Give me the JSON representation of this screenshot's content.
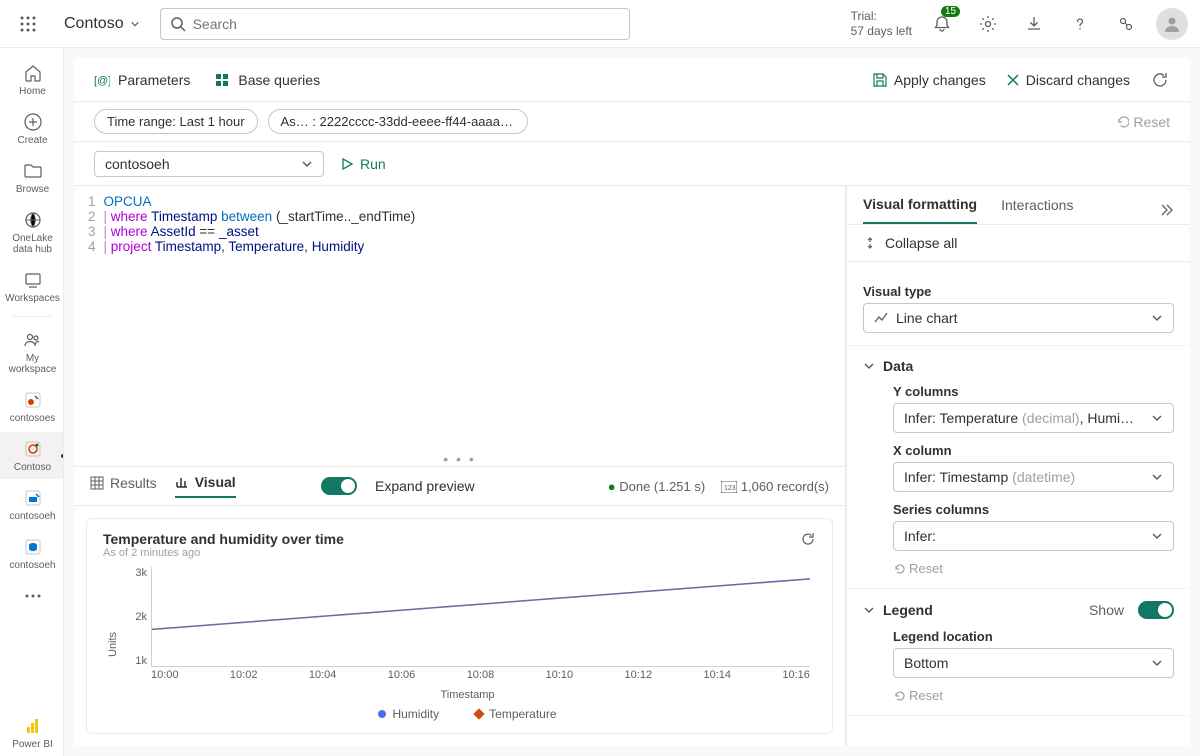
{
  "topbar": {
    "workspace": "Contoso",
    "search_placeholder": "Search",
    "trial_line1": "Trial:",
    "trial_line2": "57 days left",
    "notifications_count": "15"
  },
  "rail": {
    "items": [
      {
        "label": "Home"
      },
      {
        "label": "Create"
      },
      {
        "label": "Browse"
      },
      {
        "label": "OneLake data hub"
      },
      {
        "label": "Workspaces"
      },
      {
        "label": "My workspace"
      },
      {
        "label": "contosoes"
      },
      {
        "label": "Contoso"
      },
      {
        "label": "contosoeh"
      },
      {
        "label": "contosoeh"
      },
      {
        "label": "Power BI"
      }
    ]
  },
  "toolbar1": {
    "parameters": "Parameters",
    "base_queries": "Base queries",
    "apply": "Apply changes",
    "discard": "Discard changes"
  },
  "toolbar2": {
    "time_range": "Time range: Last 1 hour",
    "asset": "As… : 2222cccc-33dd-eeee-ff44-aaaaa…",
    "reset": "Reset"
  },
  "toolbar3": {
    "source": "contosoeh",
    "run": "Run"
  },
  "code": {
    "line_nums": [
      "1",
      "2",
      "3",
      "4"
    ],
    "l1_tbl": "OPCUA",
    "l2_pipe": "|",
    "l2_where": "where",
    "l2_col": "Timestamp",
    "l2_between": "between",
    "l2_args": "(_startTime.._endTime)",
    "l3_pipe": "|",
    "l3_where": "where",
    "l3_col": "AssetId",
    "l3_eq": "==",
    "l3_val": "_asset",
    "l4_pipe": "|",
    "l4_proj": "project",
    "l4_c1": "Timestamp",
    "l4_c2": "Temperature",
    "l4_c3": "Humidity"
  },
  "results": {
    "tab_results": "Results",
    "tab_visual": "Visual",
    "expand": "Expand preview",
    "done": "Done (1.251 s)",
    "records": "1,060 record(s)"
  },
  "chart": {
    "title": "Temperature and humidity over time",
    "subtitle": "As of 2 minutes ago",
    "y_label": "Units",
    "x_label": "Timestamp",
    "legend1": "Humidity",
    "legend2": "Temperature",
    "y_ticks": [
      "3k",
      "2k",
      "1k"
    ],
    "x_ticks": [
      "10:00",
      "10:02",
      "10:04",
      "10:06",
      "10:08",
      "10:10",
      "10:12",
      "10:14",
      "10:16"
    ]
  },
  "side": {
    "tab_visual_fmt": "Visual formatting",
    "tab_interactions": "Interactions",
    "collapse_all": "Collapse all",
    "visual_type_label": "Visual type",
    "visual_type_value": "Line chart",
    "data_section": "Data",
    "y_cols_label": "Y columns",
    "y_cols_value_prefix": "Infer: Temperature ",
    "y_cols_value_type": "(decimal)",
    "y_cols_value_suffix": ", Humi…",
    "x_col_label": "X column",
    "x_col_value_prefix": "Infer: Timestamp ",
    "x_col_value_type": "(datetime)",
    "series_label": "Series columns",
    "series_value": "Infer:",
    "reset": "Reset",
    "legend_section": "Legend",
    "legend_show": "Show",
    "legend_loc_label": "Legend location",
    "legend_loc_value": "Bottom"
  },
  "colors": {
    "accent": "#117865",
    "humidity": "#4f6bed",
    "temperature": "#ca5010"
  },
  "chart_data": {
    "type": "line",
    "title": "Temperature and humidity over time",
    "xlabel": "Timestamp",
    "ylabel": "Units",
    "ylim": [
      1000,
      3000
    ],
    "categories": [
      "10:00",
      "10:02",
      "10:04",
      "10:06",
      "10:08",
      "10:10",
      "10:12",
      "10:14",
      "10:16"
    ],
    "series": [
      {
        "name": "Humidity",
        "values": [
          1750,
          1880,
          2000,
          2120,
          2250,
          2380,
          2500,
          2620,
          2750
        ],
        "color": "#4f6bed"
      },
      {
        "name": "Temperature",
        "values": [
          1750,
          1880,
          2000,
          2120,
          2250,
          2380,
          2500,
          2620,
          2750
        ],
        "color": "#ca5010"
      }
    ]
  }
}
